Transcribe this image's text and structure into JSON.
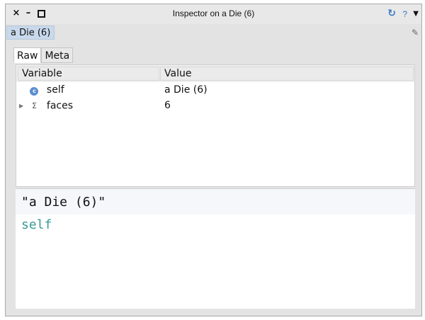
{
  "window": {
    "title": "Inspector on a Die (6)",
    "controls": {
      "close": "×",
      "minimize": "–"
    },
    "toolbar": {
      "refresh_icon": "refresh-icon",
      "help_label": "?",
      "menu_icon": "chevron-down-icon"
    }
  },
  "object_tab": {
    "label": "a Die (6)",
    "edit_icon": "pencil-icon"
  },
  "subtabs": [
    {
      "label": "Raw",
      "active": true
    },
    {
      "label": "Meta",
      "active": false
    }
  ],
  "table": {
    "columns": [
      "Variable",
      "Value"
    ],
    "rows": [
      {
        "icon": "c",
        "expandable": false,
        "variable": "self",
        "value": "a Die (6)"
      },
      {
        "icon": "Σ",
        "expandable": true,
        "variable": "faces",
        "value": "6"
      }
    ]
  },
  "code_pane": {
    "line1": "\"a Die (6)\"",
    "line2": "self"
  },
  "colors": {
    "window_bg": "#e3e3e3",
    "tab_selected": "#c9d9ec",
    "accent_blue": "#3a78c5",
    "code_keyword": "#3a9a9a"
  }
}
